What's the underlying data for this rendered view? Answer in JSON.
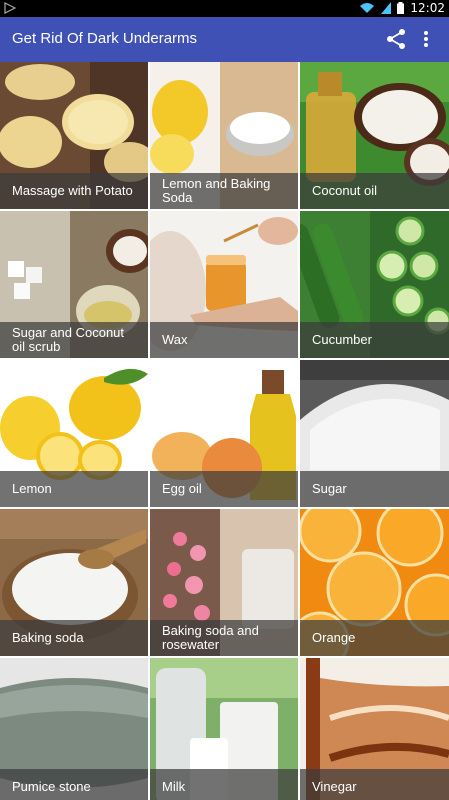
{
  "status_bar": {
    "time": "12:02"
  },
  "app_bar": {
    "title": "Get Rid Of Dark Underarms"
  },
  "tiles": [
    {
      "label": "Massage with Potato"
    },
    {
      "label": "Lemon and Baking Soda"
    },
    {
      "label": "Coconut oil"
    },
    {
      "label": "Sugar and Coconut oil scrub"
    },
    {
      "label": "Wax"
    },
    {
      "label": "Cucumber"
    },
    {
      "label": "Lemon"
    },
    {
      "label": "Egg oil"
    },
    {
      "label": "Sugar"
    },
    {
      "label": "Baking soda"
    },
    {
      "label": "Baking soda and rosewater"
    },
    {
      "label": "Orange"
    },
    {
      "label": "Pumice stone"
    },
    {
      "label": "Milk"
    },
    {
      "label": "Vinegar"
    }
  ],
  "colors": {
    "app_bar": "#3f51b5",
    "status_bar": "#000000",
    "caption_overlay": "#3c3c3c"
  },
  "icons": {
    "share": "share-icon",
    "more": "more-vert-icon",
    "wifi": "wifi-icon",
    "battery": "battery-icon",
    "signal": "signal-icon"
  }
}
